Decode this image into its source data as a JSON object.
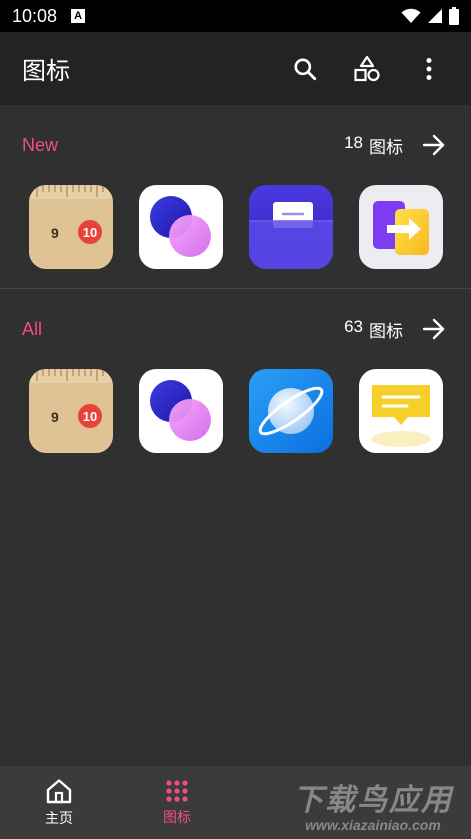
{
  "status_bar": {
    "time": "10:08",
    "notification_letter": "A"
  },
  "app_bar": {
    "title": "图标",
    "actions": [
      "search-icon",
      "shapes-icon",
      "more-vert-icon"
    ]
  },
  "sections": [
    {
      "title": "New",
      "count_number": "18",
      "count_unit": "图标",
      "icons": [
        "ruler-app-icon",
        "overlap-circles-app-icon",
        "wallet-card-app-icon",
        "app-transfer-icon"
      ]
    },
    {
      "title": "All",
      "count_number": "63",
      "count_unit": "图标",
      "icons": [
        "ruler-app-icon",
        "overlap-circles-app-icon",
        "planet-browser-app-icon",
        "message-app-icon"
      ]
    }
  ],
  "ruler_icon": {
    "left_number": "9",
    "right_number": "10"
  },
  "bottom_nav": {
    "items": [
      {
        "label": "主页",
        "icon": "home-icon",
        "active": false
      },
      {
        "label": "图标",
        "icon": "grid-icon",
        "active": true
      }
    ]
  },
  "watermark": {
    "line1": "下载鸟应用",
    "line2": "www.xiazainiao.com"
  },
  "colors": {
    "accent": "#ef4f7e",
    "background": "#303030",
    "app_bar": "#232323",
    "bottom_nav": "#3b3b3b"
  }
}
